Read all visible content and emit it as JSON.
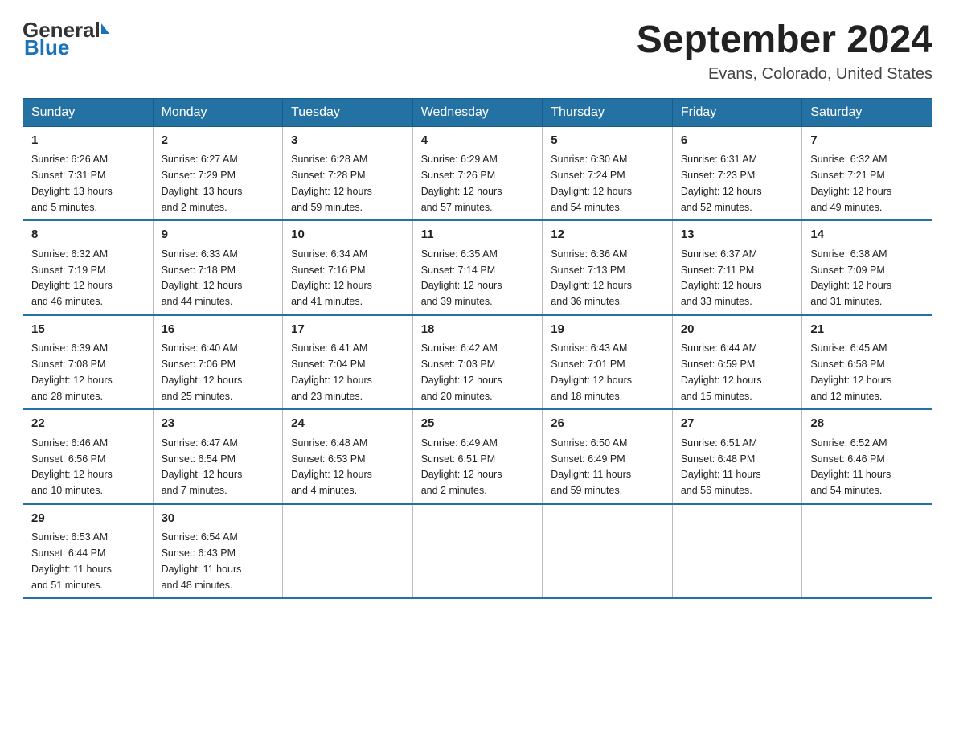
{
  "logo": {
    "general": "General",
    "blue": "Blue"
  },
  "title": "September 2024",
  "subtitle": "Evans, Colorado, United States",
  "weekdays": [
    "Sunday",
    "Monday",
    "Tuesday",
    "Wednesday",
    "Thursday",
    "Friday",
    "Saturday"
  ],
  "weeks": [
    [
      {
        "day": "1",
        "sunrise": "6:26 AM",
        "sunset": "7:31 PM",
        "daylight": "13 hours and 5 minutes."
      },
      {
        "day": "2",
        "sunrise": "6:27 AM",
        "sunset": "7:29 PM",
        "daylight": "13 hours and 2 minutes."
      },
      {
        "day": "3",
        "sunrise": "6:28 AM",
        "sunset": "7:28 PM",
        "daylight": "12 hours and 59 minutes."
      },
      {
        "day": "4",
        "sunrise": "6:29 AM",
        "sunset": "7:26 PM",
        "daylight": "12 hours and 57 minutes."
      },
      {
        "day": "5",
        "sunrise": "6:30 AM",
        "sunset": "7:24 PM",
        "daylight": "12 hours and 54 minutes."
      },
      {
        "day": "6",
        "sunrise": "6:31 AM",
        "sunset": "7:23 PM",
        "daylight": "12 hours and 52 minutes."
      },
      {
        "day": "7",
        "sunrise": "6:32 AM",
        "sunset": "7:21 PM",
        "daylight": "12 hours and 49 minutes."
      }
    ],
    [
      {
        "day": "8",
        "sunrise": "6:32 AM",
        "sunset": "7:19 PM",
        "daylight": "12 hours and 46 minutes."
      },
      {
        "day": "9",
        "sunrise": "6:33 AM",
        "sunset": "7:18 PM",
        "daylight": "12 hours and 44 minutes."
      },
      {
        "day": "10",
        "sunrise": "6:34 AM",
        "sunset": "7:16 PM",
        "daylight": "12 hours and 41 minutes."
      },
      {
        "day": "11",
        "sunrise": "6:35 AM",
        "sunset": "7:14 PM",
        "daylight": "12 hours and 39 minutes."
      },
      {
        "day": "12",
        "sunrise": "6:36 AM",
        "sunset": "7:13 PM",
        "daylight": "12 hours and 36 minutes."
      },
      {
        "day": "13",
        "sunrise": "6:37 AM",
        "sunset": "7:11 PM",
        "daylight": "12 hours and 33 minutes."
      },
      {
        "day": "14",
        "sunrise": "6:38 AM",
        "sunset": "7:09 PM",
        "daylight": "12 hours and 31 minutes."
      }
    ],
    [
      {
        "day": "15",
        "sunrise": "6:39 AM",
        "sunset": "7:08 PM",
        "daylight": "12 hours and 28 minutes."
      },
      {
        "day": "16",
        "sunrise": "6:40 AM",
        "sunset": "7:06 PM",
        "daylight": "12 hours and 25 minutes."
      },
      {
        "day": "17",
        "sunrise": "6:41 AM",
        "sunset": "7:04 PM",
        "daylight": "12 hours and 23 minutes."
      },
      {
        "day": "18",
        "sunrise": "6:42 AM",
        "sunset": "7:03 PM",
        "daylight": "12 hours and 20 minutes."
      },
      {
        "day": "19",
        "sunrise": "6:43 AM",
        "sunset": "7:01 PM",
        "daylight": "12 hours and 18 minutes."
      },
      {
        "day": "20",
        "sunrise": "6:44 AM",
        "sunset": "6:59 PM",
        "daylight": "12 hours and 15 minutes."
      },
      {
        "day": "21",
        "sunrise": "6:45 AM",
        "sunset": "6:58 PM",
        "daylight": "12 hours and 12 minutes."
      }
    ],
    [
      {
        "day": "22",
        "sunrise": "6:46 AM",
        "sunset": "6:56 PM",
        "daylight": "12 hours and 10 minutes."
      },
      {
        "day": "23",
        "sunrise": "6:47 AM",
        "sunset": "6:54 PM",
        "daylight": "12 hours and 7 minutes."
      },
      {
        "day": "24",
        "sunrise": "6:48 AM",
        "sunset": "6:53 PM",
        "daylight": "12 hours and 4 minutes."
      },
      {
        "day": "25",
        "sunrise": "6:49 AM",
        "sunset": "6:51 PM",
        "daylight": "12 hours and 2 minutes."
      },
      {
        "day": "26",
        "sunrise": "6:50 AM",
        "sunset": "6:49 PM",
        "daylight": "11 hours and 59 minutes."
      },
      {
        "day": "27",
        "sunrise": "6:51 AM",
        "sunset": "6:48 PM",
        "daylight": "11 hours and 56 minutes."
      },
      {
        "day": "28",
        "sunrise": "6:52 AM",
        "sunset": "6:46 PM",
        "daylight": "11 hours and 54 minutes."
      }
    ],
    [
      {
        "day": "29",
        "sunrise": "6:53 AM",
        "sunset": "6:44 PM",
        "daylight": "11 hours and 51 minutes."
      },
      {
        "day": "30",
        "sunrise": "6:54 AM",
        "sunset": "6:43 PM",
        "daylight": "11 hours and 48 minutes."
      },
      null,
      null,
      null,
      null,
      null
    ]
  ],
  "labels": {
    "sunrise": "Sunrise:",
    "sunset": "Sunset:",
    "daylight": "Daylight:"
  }
}
